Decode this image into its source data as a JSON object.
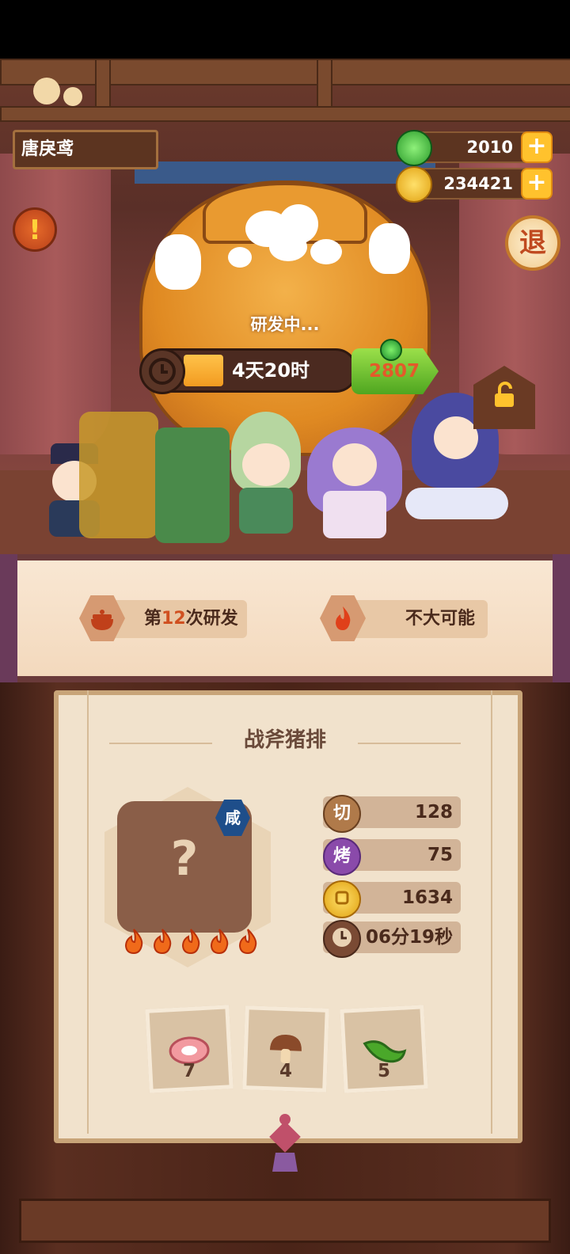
{
  "player": {
    "name": "唐戾鸢"
  },
  "currencies": {
    "jade": {
      "value": "2010",
      "icon": "jade-icon",
      "color": "#3fae3a"
    },
    "coin": {
      "value": "234421",
      "icon": "coin-icon",
      "color": "#f2b01a"
    }
  },
  "buttons": {
    "exit_label": "退",
    "alert_label": "!",
    "plus_label": "+"
  },
  "research": {
    "status": "研发中...",
    "time_left": "4天20时",
    "speedup_cost": "2807",
    "progress": 0.18
  },
  "banner": {
    "attempt_prefix": "第",
    "attempt_number": "12",
    "attempt_suffix": "次研发",
    "chance": "不大可能"
  },
  "dish": {
    "name": "战斧猪排",
    "flavor_badge": "咸",
    "unknown_mark": "?",
    "heat_level": 5,
    "stats": [
      {
        "icon_label": "切",
        "icon": "cut-icon",
        "value": "128",
        "color": "#b07a4a"
      },
      {
        "icon_label": "烤",
        "icon": "roast-icon",
        "value": "75",
        "color": "#8a4aaa"
      },
      {
        "icon_label": "",
        "icon": "coin-icon",
        "value": "1634",
        "color": "#f2b01a"
      },
      {
        "icon_label": "",
        "icon": "clock-icon",
        "value": "06分19秒",
        "color": "#7a4a34"
      }
    ],
    "ingredients": [
      {
        "icon": "meat-icon",
        "count": "7"
      },
      {
        "icon": "mushroom-icon",
        "count": "4"
      },
      {
        "icon": "green-pepper-icon",
        "count": "5"
      }
    ]
  }
}
